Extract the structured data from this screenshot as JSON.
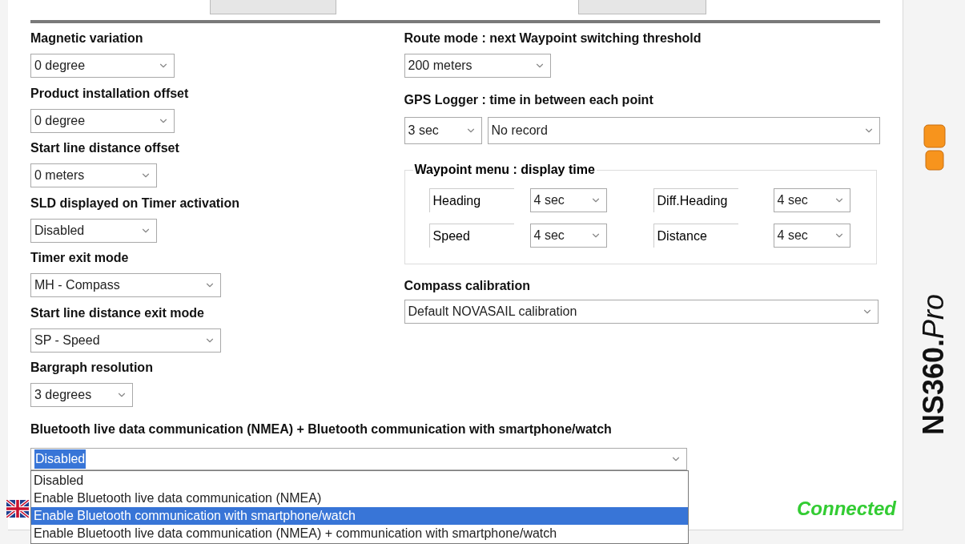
{
  "left_settings": [
    {
      "label": "Magnetic variation",
      "value": "0 degree"
    },
    {
      "label": "Product installation offset",
      "value": "0 degree"
    },
    {
      "label": "Start line distance offset",
      "value": "0 meters"
    },
    {
      "label": "SLD displayed on Timer activation",
      "value": "Disabled"
    },
    {
      "label": "Timer exit mode",
      "value": "MH - Compass"
    },
    {
      "label": "Start line distance exit mode",
      "value": "SP - Speed"
    },
    {
      "label": "Bargraph resolution",
      "value": "3 degrees"
    }
  ],
  "route_mode": {
    "label": "Route mode : next Waypoint switching threshold",
    "value": "200 meters"
  },
  "gps_logger": {
    "label": "GPS Logger : time in between each point",
    "interval": "3 sec",
    "record": "No record"
  },
  "waypoint_menu": {
    "legend": "Waypoint menu : display time",
    "items": [
      {
        "label": "Heading",
        "value": "4 sec"
      },
      {
        "label": "Diff.Heading",
        "value": "4 sec"
      },
      {
        "label": "Speed",
        "value": "4 sec"
      },
      {
        "label": "Distance",
        "value": "4 sec"
      }
    ]
  },
  "compass_calibration": {
    "label": "Compass calibration",
    "value": "Default NOVASAIL calibration"
  },
  "bluetooth": {
    "label": "Bluetooth live data communication (NMEA) + Bluetooth communication with smartphone/watch",
    "value": "Disabled",
    "expanded": true,
    "options": [
      {
        "label": "Disabled",
        "highlighted": false
      },
      {
        "label": "Enable Bluetooth live data communication (NMEA)",
        "highlighted": false
      },
      {
        "label": "Enable Bluetooth communication with smartphone/watch",
        "highlighted": true
      },
      {
        "label": "Enable Bluetooth live data communication (NMEA) + communication with smartphone/watch",
        "highlighted": false
      }
    ]
  },
  "status": "Connected",
  "logo": {
    "main": "NS360.",
    "suffix": "Pro"
  }
}
